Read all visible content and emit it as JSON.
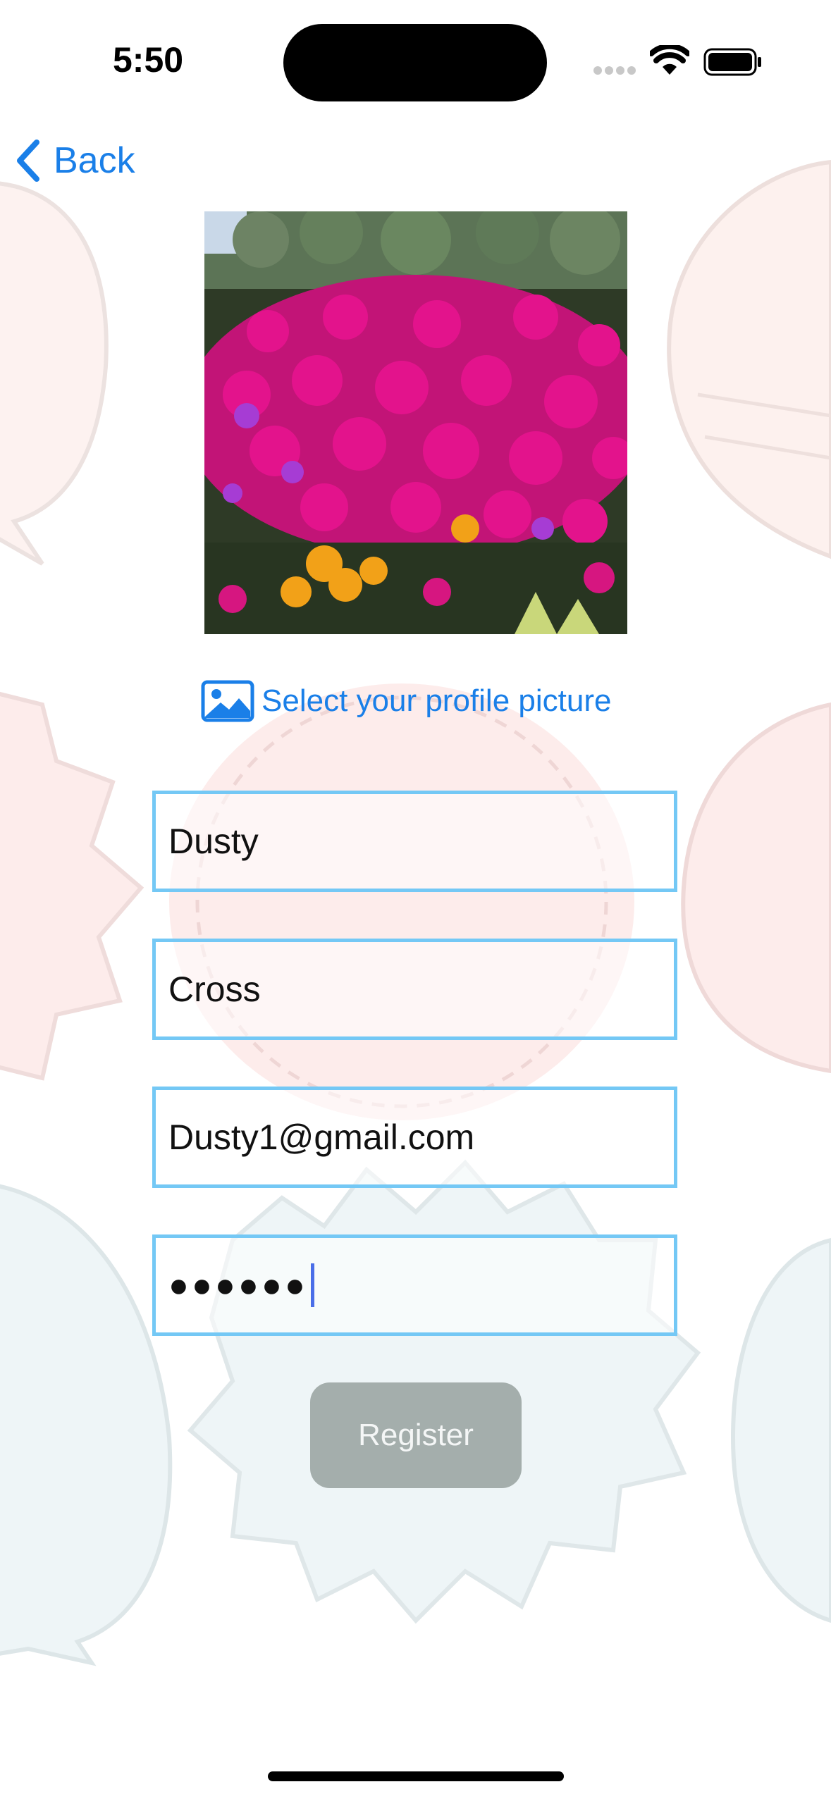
{
  "status_bar": {
    "time": "5:50"
  },
  "nav": {
    "back_label": "Back"
  },
  "profile": {
    "select_label": "Select your profile picture"
  },
  "form": {
    "first_name": "Dusty",
    "last_name": "Cross",
    "email": "Dusty1@gmail.com",
    "password_masked": "●●●●●●"
  },
  "actions": {
    "register_label": "Register"
  },
  "colors": {
    "accent": "#1a7fe8",
    "field_border": "#74c8f5",
    "button_disabled": "#a4aeac"
  }
}
